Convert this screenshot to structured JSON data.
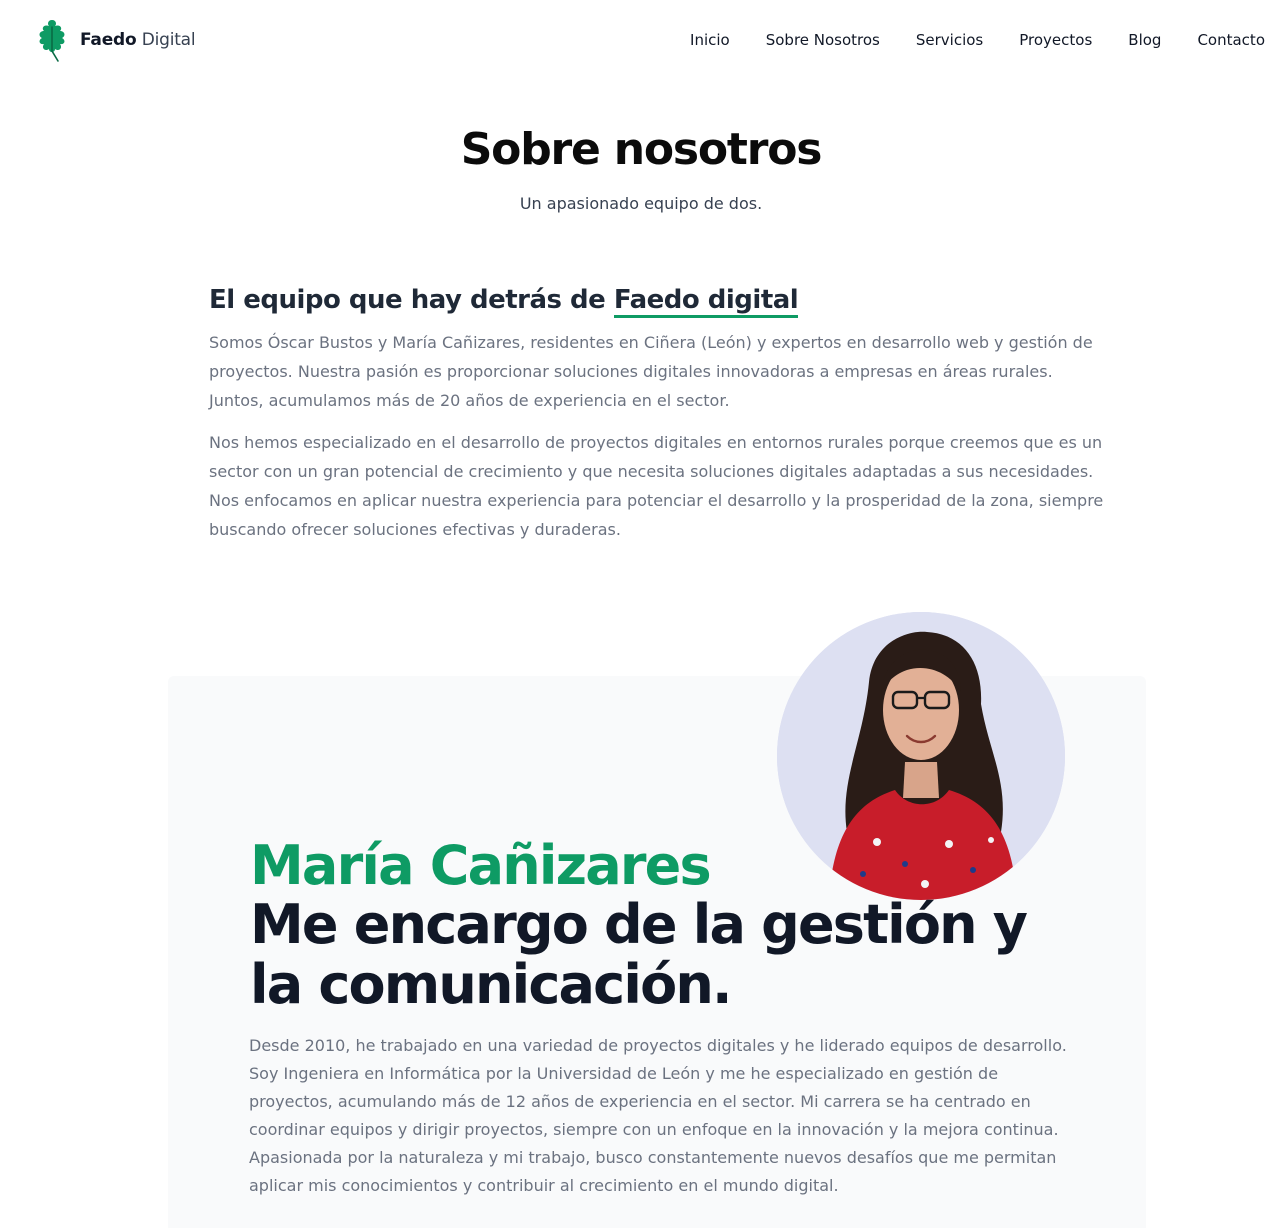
{
  "brand": {
    "name_bold": "Faedo",
    "name_light": "Digital",
    "logo_icon": "oak-leaf-icon",
    "accent_color": "#0e9b64"
  },
  "nav": {
    "items": [
      {
        "label": "Inicio"
      },
      {
        "label": "Sobre Nosotros"
      },
      {
        "label": "Servicios"
      },
      {
        "label": "Proyectos"
      },
      {
        "label": "Blog"
      },
      {
        "label": "Contacto"
      }
    ]
  },
  "hero": {
    "title": "Sobre nosotros",
    "subtitle": "Un apasionado equipo de dos."
  },
  "team": {
    "heading_prefix": "El equipo que hay detrás de ",
    "heading_highlight": "Faedo digital",
    "paragraphs": [
      "Somos Óscar Bustos y María Cañizares, residentes en Ciñera (León) y expertos en desarrollo web y gestión de proyectos. Nuestra pasión es proporcionar soluciones digitales innovadoras a empresas en áreas rurales. Juntos, acumulamos más de 20 años de experiencia en el sector.",
      "Nos hemos especializado en el desarrollo de proyectos digitales en entornos rurales porque creemos que es un sector con un gran potencial de crecimiento y que necesita soluciones digitales adaptadas a sus necesidades. Nos enfocamos en aplicar nuestra experiencia para potenciar el desarrollo y la prosperidad de la zona, siempre buscando ofrecer soluciones efectivas y duraderas."
    ]
  },
  "profile": {
    "name": "María Cañizares",
    "tagline": "Me encargo de la gestión y la comunicación.",
    "photo_icon": "profile-photo",
    "bio": "Desde 2010, he trabajado en una variedad de proyectos digitales y he liderado equipos de desarrollo. Soy Ingeniera en Informática por la Universidad de León y me he especializado en gestión de proyectos, acumulando más de 12 años de experiencia en el sector. Mi carrera se ha centrado en coordinar equipos y dirigir proyectos, siempre con un enfoque en la innovación y la mejora continua. Apasionada por la naturaleza y mi trabajo, busco constantemente nuevos desafíos que me permitan aplicar mis conocimientos y contribuir al crecimiento en el mundo digital."
  }
}
